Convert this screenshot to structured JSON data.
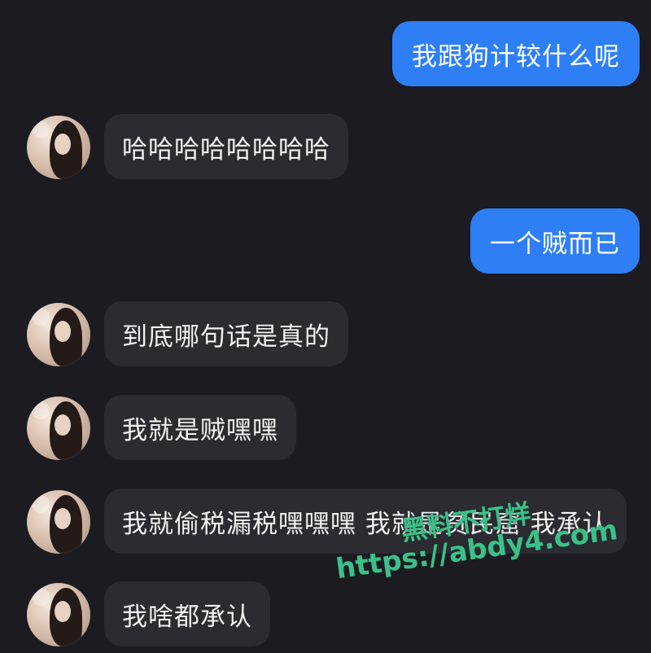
{
  "conversation": {
    "messages": [
      {
        "sender": "self",
        "text": "我跟狗计较什么呢"
      },
      {
        "sender": "other",
        "text": "哈哈哈哈哈哈哈哈"
      },
      {
        "sender": "self",
        "text": "一个贼而已"
      },
      {
        "sender": "other",
        "text": "到底哪句话是真的"
      },
      {
        "sender": "other",
        "text": "我就是贼嘿嘿"
      },
      {
        "sender": "other",
        "text": "我就偷税漏税嘿嘿嘿 我就是贫民窟 我承认"
      },
      {
        "sender": "other",
        "text": "我啥都承认"
      }
    ]
  },
  "watermark": {
    "line1": "黑料不打烊",
    "line2": "https://abdy4.com"
  },
  "colors": {
    "background": "#1b1b21",
    "incoming_bubble": "#2b2b31",
    "outgoing_bubble": "#2e7ff6",
    "watermark": "#3cc08a"
  }
}
